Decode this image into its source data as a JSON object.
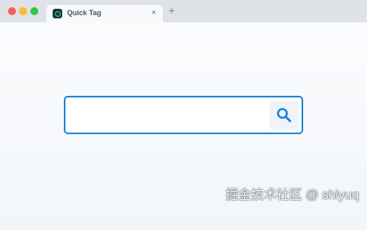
{
  "browser": {
    "tab": {
      "title": "Quick Tag",
      "close_label": "×",
      "favicon": "quick-tag-logo-icon"
    },
    "new_tab_label": "+"
  },
  "search": {
    "placeholder": "",
    "value": "",
    "button_icon": "search-icon",
    "accent_color": "#1f86d0"
  },
  "watermark": {
    "text": "掘金技术社区 @ shiyuq"
  }
}
